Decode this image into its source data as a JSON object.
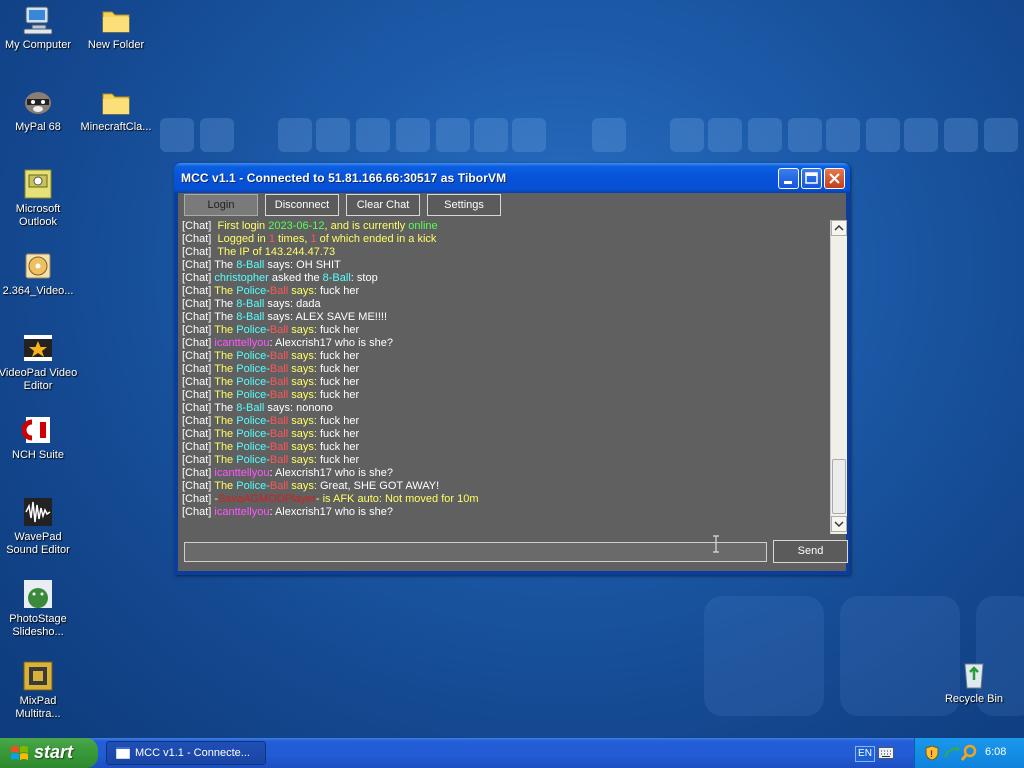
{
  "desktop": {
    "icons": [
      {
        "label": "My Computer"
      },
      {
        "label": "New Folder"
      },
      {
        "label": "MyPal 68"
      },
      {
        "label": "MinecraftCla..."
      },
      {
        "label": "Microsoft Outlook"
      },
      {
        "label": "2.364_Video..."
      },
      {
        "label": "VideoPad Video Editor"
      },
      {
        "label": "NCH Suite"
      },
      {
        "label": "WavePad Sound Editor"
      },
      {
        "label": "PhotoStage Slidesho..."
      },
      {
        "label": "MixPad Multitra..."
      },
      {
        "label": "Recycle Bin"
      }
    ]
  },
  "window": {
    "title": "MCC v1.1 - Connected to 51.81.166.66:30517 as TiborVM",
    "buttons": {
      "login": "Login",
      "disconnect": "Disconnect",
      "clear_chat": "Clear Chat",
      "settings": "Settings"
    },
    "chat_lines": [
      [
        {
          "t": "[Chat]  ",
          "c": "#ffffff"
        },
        {
          "t": "First login ",
          "c": "#ffff66"
        },
        {
          "t": "2023-06-12",
          "c": "#55ff55"
        },
        {
          "t": ", and is currently ",
          "c": "#ffff66"
        },
        {
          "t": "online",
          "c": "#55ff55"
        }
      ],
      [
        {
          "t": "[Chat]  ",
          "c": "#ffffff"
        },
        {
          "t": "Logged in ",
          "c": "#ffff66"
        },
        {
          "t": "1",
          "c": "#ff5555"
        },
        {
          "t": " times, ",
          "c": "#ffff66"
        },
        {
          "t": "1",
          "c": "#ff5555"
        },
        {
          "t": " of which ended in a kick",
          "c": "#ffff66"
        }
      ],
      [
        {
          "t": "[Chat]  ",
          "c": "#ffffff"
        },
        {
          "t": "The IP of 143.244.47.73",
          "c": "#ffff66"
        }
      ],
      [
        {
          "t": "[Chat] ",
          "c": "#ffffff"
        },
        {
          "t": "The ",
          "c": "#ffffff"
        },
        {
          "t": "8-Ball",
          "c": "#55ffff"
        },
        {
          "t": " says: OH SHIT",
          "c": "#ffffff"
        }
      ],
      [
        {
          "t": "[Chat] ",
          "c": "#ffffff"
        },
        {
          "t": "christopher",
          "c": "#55ffff"
        },
        {
          "t": " asked the ",
          "c": "#ffffff"
        },
        {
          "t": "8-Ball",
          "c": "#55ffff"
        },
        {
          "t": ": stop",
          "c": "#ffffff"
        }
      ],
      [
        {
          "t": "[Chat] ",
          "c": "#ffffff"
        },
        {
          "t": "The ",
          "c": "#ffff66"
        },
        {
          "t": "Police-",
          "c": "#55ffff"
        },
        {
          "t": "Ball",
          "c": "#ff5555"
        },
        {
          "t": " says:",
          "c": "#ffff66"
        },
        {
          "t": " fuck her",
          "c": "#ffffff"
        }
      ],
      [
        {
          "t": "[Chat] ",
          "c": "#ffffff"
        },
        {
          "t": "The ",
          "c": "#ffffff"
        },
        {
          "t": "8-Ball",
          "c": "#55ffff"
        },
        {
          "t": " says: dada",
          "c": "#ffffff"
        }
      ],
      [
        {
          "t": "[Chat] ",
          "c": "#ffffff"
        },
        {
          "t": "The ",
          "c": "#ffffff"
        },
        {
          "t": "8-Ball",
          "c": "#55ffff"
        },
        {
          "t": " says: ALEX SAVE ME!!!!",
          "c": "#ffffff"
        }
      ],
      [
        {
          "t": "[Chat] ",
          "c": "#ffffff"
        },
        {
          "t": "The ",
          "c": "#ffff66"
        },
        {
          "t": "Police-",
          "c": "#55ffff"
        },
        {
          "t": "Ball",
          "c": "#ff5555"
        },
        {
          "t": " says:",
          "c": "#ffff66"
        },
        {
          "t": " fuck her",
          "c": "#ffffff"
        }
      ],
      [
        {
          "t": "[Chat] ",
          "c": "#ffffff"
        },
        {
          "t": "icanttellyou",
          "c": "#ff55ff"
        },
        {
          "t": ": Alexcrish17 who is she?",
          "c": "#ffffff"
        }
      ],
      [
        {
          "t": "[Chat] ",
          "c": "#ffffff"
        },
        {
          "t": "The ",
          "c": "#ffff66"
        },
        {
          "t": "Police-",
          "c": "#55ffff"
        },
        {
          "t": "Ball",
          "c": "#ff5555"
        },
        {
          "t": " says:",
          "c": "#ffff66"
        },
        {
          "t": " fuck her",
          "c": "#ffffff"
        }
      ],
      [
        {
          "t": "[Chat] ",
          "c": "#ffffff"
        },
        {
          "t": "The ",
          "c": "#ffff66"
        },
        {
          "t": "Police-",
          "c": "#55ffff"
        },
        {
          "t": "Ball",
          "c": "#ff5555"
        },
        {
          "t": " says:",
          "c": "#ffff66"
        },
        {
          "t": " fuck her",
          "c": "#ffffff"
        }
      ],
      [
        {
          "t": "[Chat] ",
          "c": "#ffffff"
        },
        {
          "t": "The ",
          "c": "#ffff66"
        },
        {
          "t": "Police-",
          "c": "#55ffff"
        },
        {
          "t": "Ball",
          "c": "#ff5555"
        },
        {
          "t": " says:",
          "c": "#ffff66"
        },
        {
          "t": " fuck her",
          "c": "#ffffff"
        }
      ],
      [
        {
          "t": "[Chat] ",
          "c": "#ffffff"
        },
        {
          "t": "The ",
          "c": "#ffff66"
        },
        {
          "t": "Police-",
          "c": "#55ffff"
        },
        {
          "t": "Ball",
          "c": "#ff5555"
        },
        {
          "t": " says:",
          "c": "#ffff66"
        },
        {
          "t": " fuck her",
          "c": "#ffffff"
        }
      ],
      [
        {
          "t": "[Chat] ",
          "c": "#ffffff"
        },
        {
          "t": "The ",
          "c": "#ffffff"
        },
        {
          "t": "8-Ball",
          "c": "#55ffff"
        },
        {
          "t": " says: nonono",
          "c": "#ffffff"
        }
      ],
      [
        {
          "t": "[Chat] ",
          "c": "#ffffff"
        },
        {
          "t": "The ",
          "c": "#ffff66"
        },
        {
          "t": "Police-",
          "c": "#55ffff"
        },
        {
          "t": "Ball",
          "c": "#ff5555"
        },
        {
          "t": " says:",
          "c": "#ffff66"
        },
        {
          "t": " fuck her",
          "c": "#ffffff"
        }
      ],
      [
        {
          "t": "[Chat] ",
          "c": "#ffffff"
        },
        {
          "t": "The ",
          "c": "#ffff66"
        },
        {
          "t": "Police-",
          "c": "#55ffff"
        },
        {
          "t": "Ball",
          "c": "#ff5555"
        },
        {
          "t": " says:",
          "c": "#ffff66"
        },
        {
          "t": " fuck her",
          "c": "#ffffff"
        }
      ],
      [
        {
          "t": "[Chat] ",
          "c": "#ffffff"
        },
        {
          "t": "The ",
          "c": "#ffff66"
        },
        {
          "t": "Police-",
          "c": "#55ffff"
        },
        {
          "t": "Ball",
          "c": "#ff5555"
        },
        {
          "t": " says:",
          "c": "#ffff66"
        },
        {
          "t": " fuck her",
          "c": "#ffffff"
        }
      ],
      [
        {
          "t": "[Chat] ",
          "c": "#ffffff"
        },
        {
          "t": "The ",
          "c": "#ffff66"
        },
        {
          "t": "Police-",
          "c": "#55ffff"
        },
        {
          "t": "Ball",
          "c": "#ff5555"
        },
        {
          "t": " says:",
          "c": "#ffff66"
        },
        {
          "t": " fuck her",
          "c": "#ffffff"
        }
      ],
      [
        {
          "t": "[Chat] ",
          "c": "#ffffff"
        },
        {
          "t": "icanttellyou",
          "c": "#ff55ff"
        },
        {
          "t": ": Alexcrish17 who is she?",
          "c": "#ffffff"
        }
      ],
      [
        {
          "t": "[Chat] ",
          "c": "#ffffff"
        },
        {
          "t": "The ",
          "c": "#ffff66"
        },
        {
          "t": "Police-",
          "c": "#55ffff"
        },
        {
          "t": "Ball",
          "c": "#ff5555"
        },
        {
          "t": " says:",
          "c": "#ffff66"
        },
        {
          "t": " Great, SHE GOT AWAY!",
          "c": "#ffffff"
        }
      ],
      [
        {
          "t": "[Chat] ",
          "c": "#ffffff"
        },
        {
          "t": "-",
          "c": "#ffff66"
        },
        {
          "t": "SavaAGMODPlayer",
          "c": "#cc2222"
        },
        {
          "t": "- is AFK auto: Not moved for 10m",
          "c": "#ffff66"
        }
      ],
      [
        {
          "t": "[Chat] ",
          "c": "#ffffff"
        },
        {
          "t": "icanttellyou",
          "c": "#ff55ff"
        },
        {
          "t": ": Alexcrish17 who is she?",
          "c": "#ffffff"
        }
      ]
    ],
    "input_value": "",
    "send_label": "Send"
  },
  "taskbar": {
    "start_label": "start",
    "task_item_label": "MCC v1.1 - Connecte...",
    "language": "EN",
    "clock": "6:08"
  },
  "colors": {
    "chat_background": "#606060",
    "titlebar": "#0752d8",
    "start_button": "#3b9a3a"
  }
}
